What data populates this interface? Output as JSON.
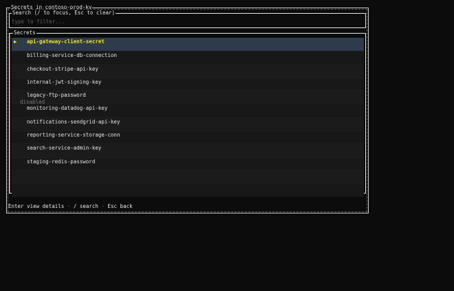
{
  "window": {
    "title": "Secrets in contoso-prod-kv"
  },
  "search": {
    "title": "Search (/ to focus, Esc to clear)",
    "placeholder": "type to filter...",
    "value": ""
  },
  "list": {
    "title": "Secrets",
    "selected_marker": "▶",
    "items": [
      {
        "name": "api-gateway-client-secret",
        "selected": true,
        "tag": ""
      },
      {
        "name": "billing-service-db-connection",
        "selected": false,
        "tag": ""
      },
      {
        "name": "checkout-stripe-api-key",
        "selected": false,
        "tag": ""
      },
      {
        "name": "internal-jwt-signing-key",
        "selected": false,
        "tag": ""
      },
      {
        "name": "legacy-ftp-password",
        "selected": false,
        "tag": ""
      },
      {
        "name": "monitoring-datadog-api-key",
        "selected": false,
        "tag": "disabled"
      },
      {
        "name": "notifications-sendgrid-api-key",
        "selected": false,
        "tag": ""
      },
      {
        "name": "reporting-service-storage-conn",
        "selected": false,
        "tag": ""
      },
      {
        "name": "search-service-admin-key",
        "selected": false,
        "tag": ""
      },
      {
        "name": "staging-redis-password",
        "selected": false,
        "tag": ""
      },
      {
        "name": "",
        "selected": false,
        "tag": ""
      },
      {
        "name": "",
        "selected": false,
        "tag": ""
      }
    ]
  },
  "footer": {
    "hint1": "Enter view details",
    "sep": "·",
    "hint2": "/ search",
    "hint3": "Esc back"
  },
  "colors": {
    "background": "#0c0c0c",
    "selected_text": "#f0e22a",
    "selected_row": "#2e3b4a",
    "muted": "#7a7a7a"
  }
}
